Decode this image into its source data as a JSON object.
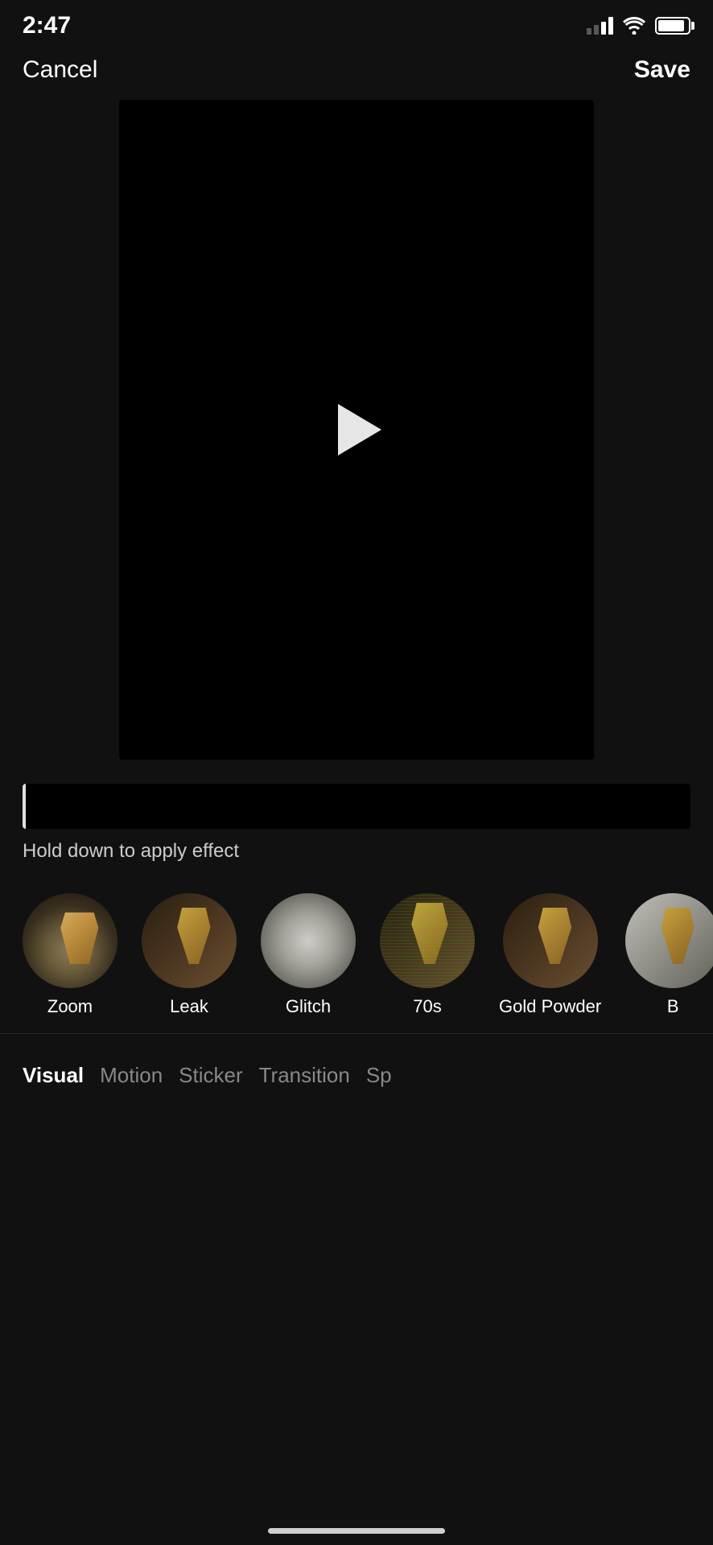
{
  "statusBar": {
    "time": "2:47",
    "signal": [
      1,
      2,
      3,
      4
    ],
    "signalActive": [
      1,
      2
    ],
    "battery": 90
  },
  "nav": {
    "cancelLabel": "Cancel",
    "saveLabel": "Save"
  },
  "video": {
    "placeholder": "black"
  },
  "timeline": {
    "holdText": "Hold down to apply effect"
  },
  "effects": [
    {
      "id": "zoom",
      "label": "Zoom",
      "thumbClass": "thumb-zoom"
    },
    {
      "id": "leak",
      "label": "Leak",
      "thumbClass": "thumb-leak"
    },
    {
      "id": "glitch",
      "label": "Glitch",
      "thumbClass": "thumb-glitch"
    },
    {
      "id": "70s",
      "label": "70s",
      "thumbClass": "thumb-70s"
    },
    {
      "id": "gold-powder",
      "label": "Gold Powder",
      "thumbClass": "thumb-gold"
    },
    {
      "id": "partial",
      "label": "B...",
      "thumbClass": "thumb-partial"
    }
  ],
  "categories": [
    {
      "id": "visual",
      "label": "Visual",
      "active": true
    },
    {
      "id": "motion",
      "label": "Motion",
      "active": false
    },
    {
      "id": "sticker",
      "label": "Sticker",
      "active": false
    },
    {
      "id": "transition",
      "label": "Transition",
      "active": false
    },
    {
      "id": "sp",
      "label": "Sp",
      "active": false
    }
  ]
}
